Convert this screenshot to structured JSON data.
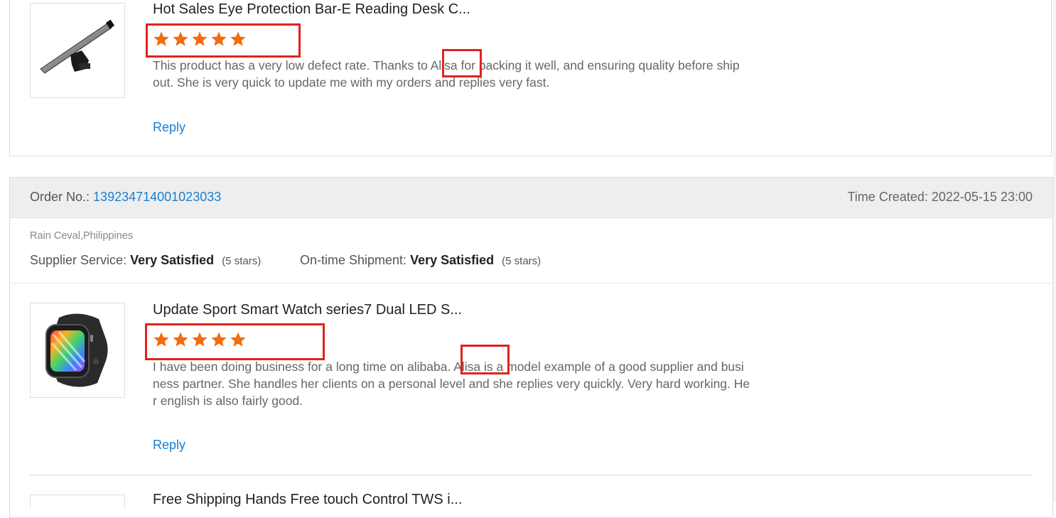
{
  "review_1": {
    "title": "Hot Sales Eye Protection Bar-E Reading Desk C...",
    "rating": 5,
    "text_line_1_before": "This product has a very low defect rate. Thanks to ",
    "text_name": "Alisa",
    "text_line_1_after": " for packing it well, and ensuring quality before ship",
    "text_line_2": "out. She is very quick to update me with my orders and replies very fast.",
    "reply_label": "Reply",
    "product_image": "desk-lamp-bar-image"
  },
  "order": {
    "order_no_label": "Order No.:",
    "order_no_value": "139234714001023033",
    "time_created_label": "Time Created:",
    "time_created_value": "2022-05-15 23:00",
    "buyer": "Rain Ceval,Philippines",
    "supplier_service_label": "Supplier Service:",
    "supplier_service_value": "Very Satisfied",
    "supplier_service_stars": "(5 stars)",
    "ontime_label": "On-time Shipment:",
    "ontime_value": "Very Satisfied",
    "ontime_stars": "(5 stars)"
  },
  "review_2": {
    "title": "Update Sport Smart Watch series7 Dual LED S...",
    "rating": 5,
    "text_line_1_before": "I have been doing business for a long time on alibaba. ",
    "text_name": "Alisa",
    "text_line_1_after": " is a model example of a good supplier and busi",
    "text_line_2": "ness partner. She handles her clients on a personal level and she replies very quickly. Very hard working. He",
    "text_line_3": "r english is also fairly good.",
    "reply_label": "Reply",
    "product_image": "smart-watch-image"
  },
  "review_3": {
    "title": "Free Shipping Hands Free touch Control TWS i..."
  },
  "colors": {
    "star": "#f36c10",
    "link": "#1a7fd1",
    "highlight": "#e0221e",
    "header_bg": "#eeeeee"
  }
}
